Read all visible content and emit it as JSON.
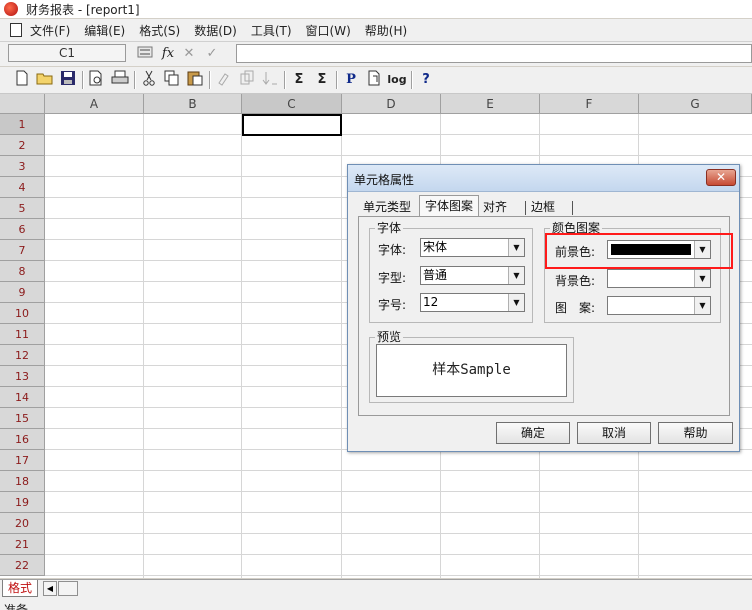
{
  "window": {
    "title": "财务报表 - [report1]"
  },
  "menu": [
    "文件(F)",
    "编辑(E)",
    "格式(S)",
    "数据(D)",
    "工具(T)",
    "窗口(W)",
    "帮助(H)"
  ],
  "formula_bar": {
    "cell_ref": "C1",
    "fx_label": "fx",
    "cancel": "✕",
    "confirm": "✓",
    "value": ""
  },
  "toolbar": {
    "icons": [
      "new-icon",
      "open-icon",
      "save-icon",
      "print-preview-icon",
      "print-icon",
      "cut-icon",
      "copy-icon",
      "paste-icon",
      "format-painter-icon",
      "insert-icon",
      "sort-icon",
      "sum-icon",
      "sum-all-icon",
      "p-icon",
      "page-icon",
      "log-icon",
      "help-icon"
    ],
    "p_label": "P",
    "log_label": "log",
    "sum_label": "Σ",
    "help_label": "?"
  },
  "sheet": {
    "columns": [
      "A",
      "B",
      "C",
      "D",
      "E",
      "F",
      "G"
    ],
    "rows": [
      "1",
      "2",
      "3",
      "4",
      "5",
      "6",
      "7",
      "8",
      "9",
      "10",
      "11",
      "12",
      "13",
      "14",
      "15",
      "16",
      "17",
      "18",
      "19",
      "20",
      "21",
      "22"
    ],
    "active_cell": "C1"
  },
  "sheet_tabs": {
    "active": "格式"
  },
  "status": {
    "text": "准备"
  },
  "dialog": {
    "title": "单元格属性",
    "close": "✕",
    "tabs": [
      "单元类型",
      "字体图案",
      "对齐",
      "边框"
    ],
    "active_tab": "字体图案",
    "font_group": {
      "label": "字体",
      "font_label": "字体:",
      "font_value": "宋体",
      "style_label": "字型:",
      "style_value": "普通",
      "size_label": "字号:",
      "size_value": "12"
    },
    "color_group": {
      "label": "颜色图案",
      "fg_label": "前景色:",
      "fg_color": "#000000",
      "bg_label": "背景色:",
      "bg_color": "#ffffff",
      "pattern_label": "图　案:"
    },
    "preview": {
      "label": "预览",
      "sample": "样本Sample"
    },
    "buttons": {
      "ok": "确定",
      "cancel": "取消",
      "help": "帮助"
    }
  },
  "colors": {
    "highlight": "#ff1a1a",
    "row_header_text": "#8b1a1a",
    "tab_text": "#c01010"
  }
}
